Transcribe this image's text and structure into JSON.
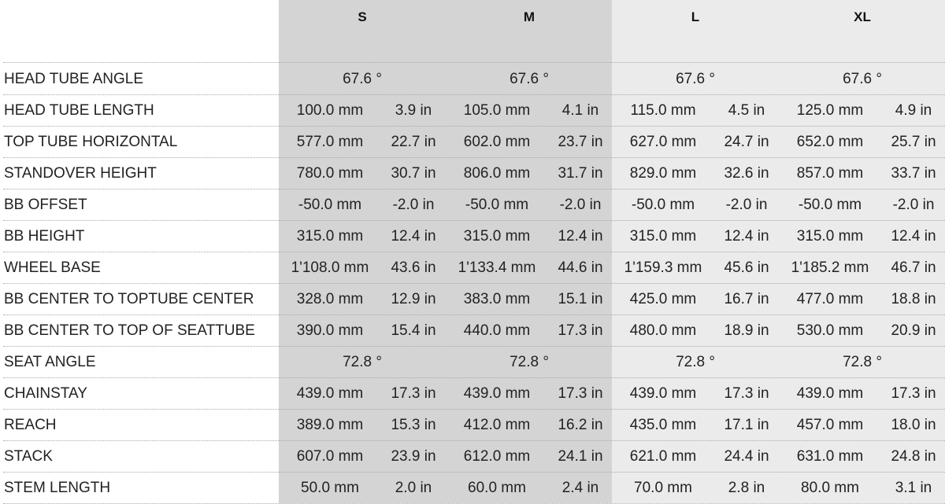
{
  "sizes": [
    "S",
    "M",
    "L",
    "XL"
  ],
  "rows": [
    {
      "label": "HEAD TUBE ANGLE",
      "span": true,
      "values": [
        "67.6 °",
        "67.6 °",
        "67.6 °",
        "67.6 °"
      ]
    },
    {
      "label": "HEAD TUBE LENGTH",
      "values": [
        [
          "100.0 mm",
          "3.9 in"
        ],
        [
          "105.0 mm",
          "4.1 in"
        ],
        [
          "115.0 mm",
          "4.5 in"
        ],
        [
          "125.0 mm",
          "4.9 in"
        ]
      ]
    },
    {
      "label": "TOP TUBE HORIZONTAL",
      "values": [
        [
          "577.0 mm",
          "22.7 in"
        ],
        [
          "602.0 mm",
          "23.7 in"
        ],
        [
          "627.0 mm",
          "24.7 in"
        ],
        [
          "652.0 mm",
          "25.7 in"
        ]
      ]
    },
    {
      "label": "STANDOVER HEIGHT",
      "values": [
        [
          "780.0 mm",
          "30.7 in"
        ],
        [
          "806.0 mm",
          "31.7 in"
        ],
        [
          "829.0 mm",
          "32.6 in"
        ],
        [
          "857.0 mm",
          "33.7 in"
        ]
      ]
    },
    {
      "label": "BB OFFSET",
      "values": [
        [
          "-50.0 mm",
          "-2.0 in"
        ],
        [
          "-50.0 mm",
          "-2.0 in"
        ],
        [
          "-50.0 mm",
          "-2.0 in"
        ],
        [
          "-50.0 mm",
          "-2.0 in"
        ]
      ]
    },
    {
      "label": "BB HEIGHT",
      "values": [
        [
          "315.0 mm",
          "12.4 in"
        ],
        [
          "315.0 mm",
          "12.4 in"
        ],
        [
          "315.0 mm",
          "12.4 in"
        ],
        [
          "315.0 mm",
          "12.4 in"
        ]
      ]
    },
    {
      "label": "WHEEL BASE",
      "values": [
        [
          "1'108.0 mm",
          "43.6 in"
        ],
        [
          "1'133.4 mm",
          "44.6 in"
        ],
        [
          "1'159.3 mm",
          "45.6 in"
        ],
        [
          "1'185.2 mm",
          "46.7 in"
        ]
      ]
    },
    {
      "label": "BB CENTER TO TOPTUBE CENTER",
      "values": [
        [
          "328.0 mm",
          "12.9 in"
        ],
        [
          "383.0 mm",
          "15.1 in"
        ],
        [
          "425.0 mm",
          "16.7 in"
        ],
        [
          "477.0 mm",
          "18.8 in"
        ]
      ]
    },
    {
      "label": "BB CENTER TO TOP OF SEATTUBE",
      "values": [
        [
          "390.0 mm",
          "15.4 in"
        ],
        [
          "440.0 mm",
          "17.3 in"
        ],
        [
          "480.0 mm",
          "18.9 in"
        ],
        [
          "530.0 mm",
          "20.9 in"
        ]
      ]
    },
    {
      "label": "SEAT ANGLE",
      "span": true,
      "values": [
        "72.8 °",
        "72.8 °",
        "72.8 °",
        "72.8 °"
      ]
    },
    {
      "label": "CHAINSTAY",
      "values": [
        [
          "439.0 mm",
          "17.3 in"
        ],
        [
          "439.0 mm",
          "17.3 in"
        ],
        [
          "439.0 mm",
          "17.3 in"
        ],
        [
          "439.0 mm",
          "17.3 in"
        ]
      ]
    },
    {
      "label": "REACH",
      "values": [
        [
          "389.0 mm",
          "15.3 in"
        ],
        [
          "412.0 mm",
          "16.2 in"
        ],
        [
          "435.0 mm",
          "17.1 in"
        ],
        [
          "457.0 mm",
          "18.0 in"
        ]
      ]
    },
    {
      "label": "STACK",
      "values": [
        [
          "607.0 mm",
          "23.9 in"
        ],
        [
          "612.0 mm",
          "24.1 in"
        ],
        [
          "621.0 mm",
          "24.4 in"
        ],
        [
          "631.0 mm",
          "24.8 in"
        ]
      ]
    },
    {
      "label": "STEM LENGTH",
      "values": [
        [
          "50.0 mm",
          "2.0 in"
        ],
        [
          "60.0 mm",
          "2.4 in"
        ],
        [
          "70.0 mm",
          "2.8 in"
        ],
        [
          "80.0 mm",
          "3.1 in"
        ]
      ]
    }
  ],
  "colors": {
    "shade_s_m": "#d4d4d4",
    "shade_l_xl": "#ebebeb",
    "text": "#222222"
  }
}
